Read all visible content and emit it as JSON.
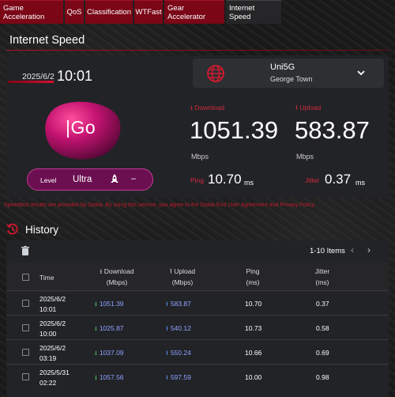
{
  "tabs": [
    {
      "label": "Game Acceleration",
      "active": false
    },
    {
      "label": "QoS",
      "active": false
    },
    {
      "label": "Classification",
      "active": false
    },
    {
      "label": "WTFast",
      "active": false
    },
    {
      "label": "Gear Accelerator",
      "active": false
    },
    {
      "label": "Internet Speed",
      "active": true
    }
  ],
  "page_title": "Internet Speed",
  "result": {
    "date": "2025/6/2",
    "time": "10:01",
    "server_name": "Uni5G",
    "server_location": "George Town",
    "logo_text": "Go",
    "download_label": "Download",
    "upload_label": "Upload",
    "download_value": "1051.39",
    "upload_value": "583.87",
    "download_unit": "Mbps",
    "upload_unit": "Mbps",
    "level_label": "Level",
    "level_value": "Ultra",
    "level_extra": "–",
    "ping_label": "Ping",
    "ping_value": "10.70",
    "ping_unit": "ms",
    "jitter_label": "Jitter",
    "jitter_value": "0.37",
    "jitter_unit": "ms"
  },
  "disclaimer": "Speedtest results are provided by Ookla. By using this service, you agree to the Ookla End User Agreement and Privacy Policy.",
  "history": {
    "title": "History",
    "items_label": "1-10 Items",
    "columns": {
      "time": "Time",
      "download": "Download",
      "download_unit": "(Mbps)",
      "upload": "Upload",
      "upload_unit": "(Mbps)",
      "ping": "Ping",
      "ping_unit": "(ms)",
      "jitter": "Jitter",
      "jitter_unit": "(ms)"
    },
    "rows": [
      {
        "date": "2025/6/2",
        "time": "10:01",
        "download": "1051.39",
        "upload": "583.87",
        "ping": "10.70",
        "jitter": "0.37"
      },
      {
        "date": "2025/6/2",
        "time": "10:00",
        "download": "1025.87",
        "upload": "540.12",
        "ping": "10.73",
        "jitter": "0.58"
      },
      {
        "date": "2025/6/2",
        "time": "03:19",
        "download": "1037.09",
        "upload": "550.24",
        "ping": "10.66",
        "jitter": "0.69"
      },
      {
        "date": "2025/5/31",
        "time": "02:22",
        "download": "1057.56",
        "upload": "597.59",
        "ping": "10.00",
        "jitter": "0.98"
      }
    ]
  },
  "colors": {
    "accent_red": "#b30e2c",
    "tab_red": "#7a0616",
    "level_purple": "#6b0f50",
    "value_blue": "#8fa3ff",
    "download_arrow": "#4cd06a",
    "upload_arrow": "#5c9bff"
  },
  "icons": {
    "server": "globe-icon",
    "dropdown": "chevron-down-icon",
    "level": "rocket-icon",
    "history": "history-clock-icon",
    "delete": "trash-icon",
    "prev": "chevron-left-icon",
    "next": "chevron-right-icon"
  }
}
